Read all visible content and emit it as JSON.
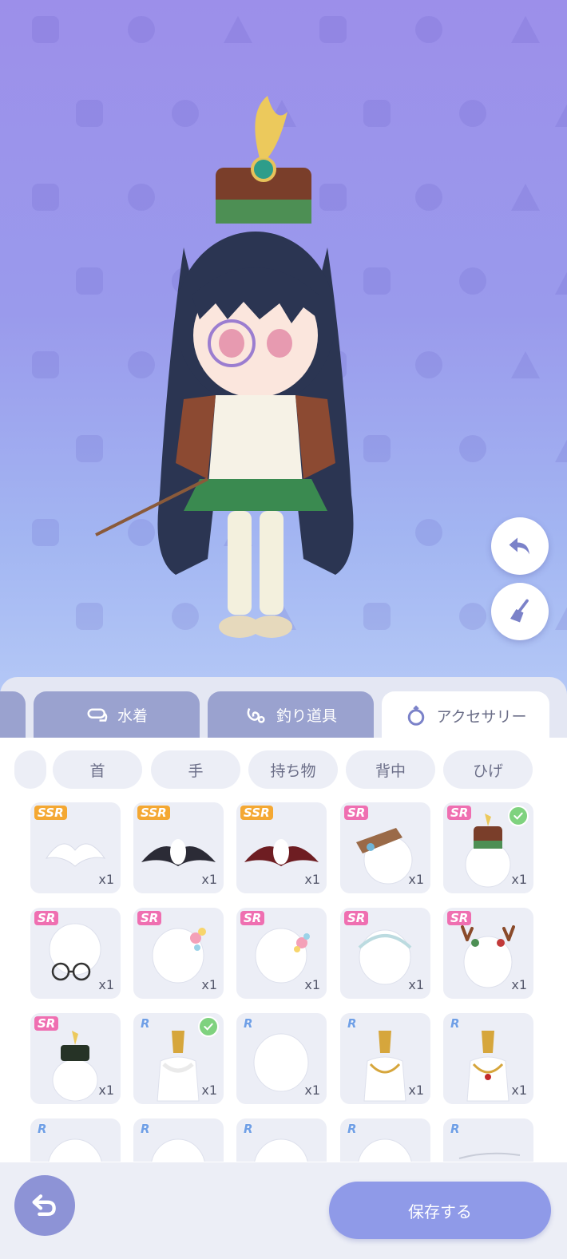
{
  "category_tabs": [
    {
      "label": "",
      "icon": "partial-tab"
    },
    {
      "label": "水着",
      "icon": "goggles-icon"
    },
    {
      "label": "釣り道具",
      "icon": "fishing-lure-icon"
    },
    {
      "label": "アクセサリー",
      "icon": "ring-icon",
      "active": true
    }
  ],
  "subcategories": [
    "首",
    "手",
    "持ち物",
    "背中",
    "ひげ"
  ],
  "items": [
    {
      "rarity": "SSR",
      "qty": "x1",
      "art": "white-wings"
    },
    {
      "rarity": "SSR",
      "qty": "x1",
      "art": "black-white-wings"
    },
    {
      "rarity": "SSR",
      "qty": "x1",
      "art": "dark-red-wings"
    },
    {
      "rarity": "SR",
      "qty": "x1",
      "art": "brown-hat"
    },
    {
      "rarity": "SR",
      "qty": "x1",
      "art": "band-hat",
      "equipped": true
    },
    {
      "rarity": "SR",
      "qty": "x1",
      "art": "round-glasses"
    },
    {
      "rarity": "SR",
      "qty": "x1",
      "art": "flower-hairpin"
    },
    {
      "rarity": "SR",
      "qty": "x1",
      "art": "flower-hairpin-2"
    },
    {
      "rarity": "SR",
      "qty": "x1",
      "art": "headband"
    },
    {
      "rarity": "SR",
      "qty": "x1",
      "art": "antlers"
    },
    {
      "rarity": "SR",
      "qty": "x1",
      "art": "military-cap"
    },
    {
      "rarity": "R",
      "qty": "x1",
      "art": "white-necklace",
      "equipped": true
    },
    {
      "rarity": "R",
      "qty": "x1",
      "art": "head-blank"
    },
    {
      "rarity": "R",
      "qty": "x1",
      "art": "gold-necklace"
    },
    {
      "rarity": "R",
      "qty": "x1",
      "art": "ruby-necklace"
    },
    {
      "rarity": "R",
      "qty": "",
      "art": "head-blank"
    },
    {
      "rarity": "R",
      "qty": "",
      "art": "head-blank"
    },
    {
      "rarity": "R",
      "qty": "",
      "art": "head-blank"
    },
    {
      "rarity": "R",
      "qty": "",
      "art": "head-blank"
    },
    {
      "rarity": "R",
      "qty": "",
      "art": "thin-chain"
    }
  ],
  "actions": {
    "save_label": "保存する",
    "undo_icon": "undo-arrow-icon",
    "clear_icon": "broom-icon",
    "back_icon": "back-arrow-icon"
  },
  "colors": {
    "bg_top": "#9c8fea",
    "bg_bottom": "#b4c8f6",
    "tab_inactive": "#9aa2cf",
    "save_button": "#8f9ae8",
    "ssr": "#f4a833",
    "sr": "#ef6fb1",
    "r": "#6f9fe6",
    "equipped": "#7fd27f"
  }
}
